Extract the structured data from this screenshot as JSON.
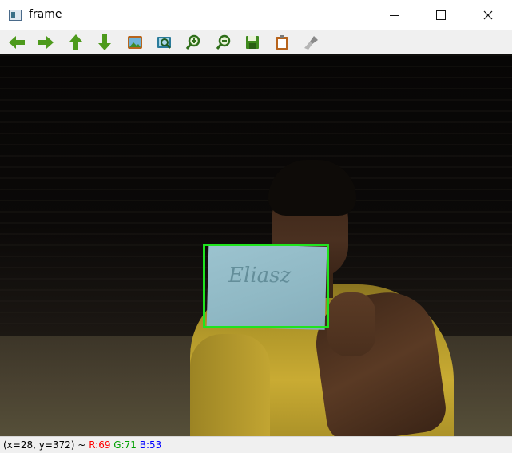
{
  "window": {
    "title": "frame",
    "controls": {
      "minimize_icon": "minimize-icon",
      "maximize_icon": "maximize-icon",
      "close_icon": "close-icon"
    }
  },
  "toolbar": {
    "tools": [
      {
        "name": "pan-left",
        "icon": "arrow-left-icon"
      },
      {
        "name": "pan-right",
        "icon": "arrow-right-icon"
      },
      {
        "name": "pan-up",
        "icon": "arrow-up-icon"
      },
      {
        "name": "pan-down",
        "icon": "arrow-down-icon"
      },
      {
        "name": "zoom-original",
        "icon": "image-icon"
      },
      {
        "name": "zoom-fit",
        "icon": "zoom-image-icon"
      },
      {
        "name": "zoom-in",
        "icon": "zoom-in-icon"
      },
      {
        "name": "zoom-out",
        "icon": "zoom-out-icon"
      },
      {
        "name": "save",
        "icon": "save-icon"
      },
      {
        "name": "copy-clipboard",
        "icon": "clipboard-icon"
      },
      {
        "name": "properties",
        "icon": "brush-icon"
      }
    ]
  },
  "image": {
    "detection_box_color": "#1fe41f",
    "paper_writing": "Eliasz"
  },
  "status": {
    "coords": "(x=28, y=372) ~",
    "r": "R:69",
    "g": "G:71",
    "b": "B:53"
  }
}
